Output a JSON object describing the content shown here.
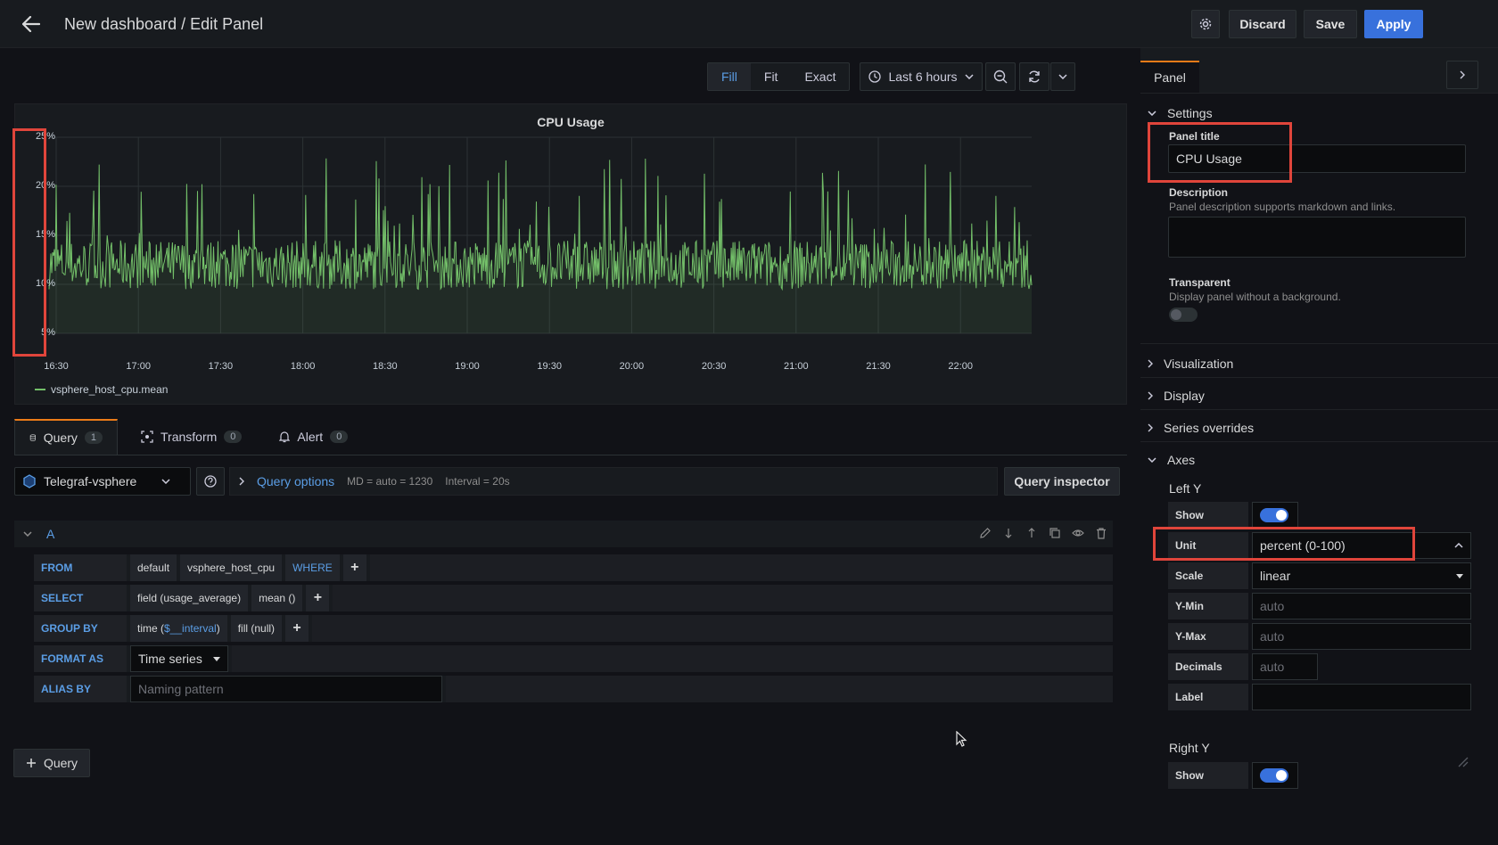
{
  "header": {
    "title": "New dashboard / Edit Panel",
    "discard_label": "Discard",
    "save_label": "Save",
    "apply_label": "Apply"
  },
  "toolbar": {
    "fill_label": "Fill",
    "fit_label": "Fit",
    "exact_label": "Exact",
    "time_range": "Last 6 hours"
  },
  "panel": {
    "title": "CPU Usage",
    "legend_label": "vsphere_host_cpu.mean"
  },
  "chart_data": {
    "type": "line",
    "title": "CPU Usage",
    "xlabel": "",
    "ylabel": "",
    "x_ticks": [
      "16:30",
      "17:00",
      "17:30",
      "18:00",
      "18:30",
      "19:00",
      "19:30",
      "20:00",
      "20:30",
      "21:00",
      "21:30",
      "22:00"
    ],
    "y_ticks": [
      "5%",
      "10%",
      "15%",
      "20%",
      "25%"
    ],
    "ylim": [
      5,
      25
    ],
    "series": [
      {
        "name": "vsphere_host_cpu.mean",
        "color": "#73bf69",
        "baseline": 12,
        "spike_max": 23
      }
    ],
    "grid": true,
    "legend": "bottom-left"
  },
  "query_tabs": [
    {
      "label": "Query",
      "count": "1"
    },
    {
      "label": "Transform",
      "count": "0"
    },
    {
      "label": "Alert",
      "count": "0"
    }
  ],
  "datasource": {
    "name": "Telegraf-vsphere",
    "query_options_label": "Query options",
    "md_text": "MD = auto = 1230",
    "interval_text": "Interval = 20s",
    "inspector_label": "Query inspector"
  },
  "query": {
    "ref_id": "A",
    "from_kw": "FROM",
    "from_policy": "default",
    "from_measurement": "vsphere_host_cpu",
    "where_kw": "WHERE",
    "select_kw": "SELECT",
    "select_field": "field (usage_average)",
    "select_fn": "mean ()",
    "group_kw": "GROUP BY",
    "group_time_prefix": "time (",
    "group_time_var": "$__interval",
    "group_time_suffix": ")",
    "group_fill": "fill (null)",
    "format_kw": "FORMAT AS",
    "format_value": "Time series",
    "alias_kw": "ALIAS BY",
    "alias_placeholder": "Naming pattern"
  },
  "add_query_label": "Query",
  "options_pane": {
    "tab_label": "Panel",
    "settings_label": "Settings",
    "panel_title_label": "Panel title",
    "panel_title_value": "CPU Usage",
    "description_label": "Description",
    "description_help": "Panel description supports markdown and links.",
    "transparent_label": "Transparent",
    "transparent_help": "Display panel without a background.",
    "visualization_label": "Visualization",
    "display_label": "Display",
    "series_overrides_label": "Series overrides",
    "axes_label": "Axes",
    "left_y_label": "Left Y",
    "show_label": "Show",
    "unit_label": "Unit",
    "unit_value": "percent (0-100)",
    "scale_label": "Scale",
    "scale_value": "linear",
    "ymin_label": "Y-Min",
    "ymin_placeholder": "auto",
    "ymax_label": "Y-Max",
    "ymax_placeholder": "auto",
    "decimals_label": "Decimals",
    "decimals_placeholder": "auto",
    "label_label": "Label",
    "right_y_label": "Right Y",
    "right_show_label": "Show"
  }
}
